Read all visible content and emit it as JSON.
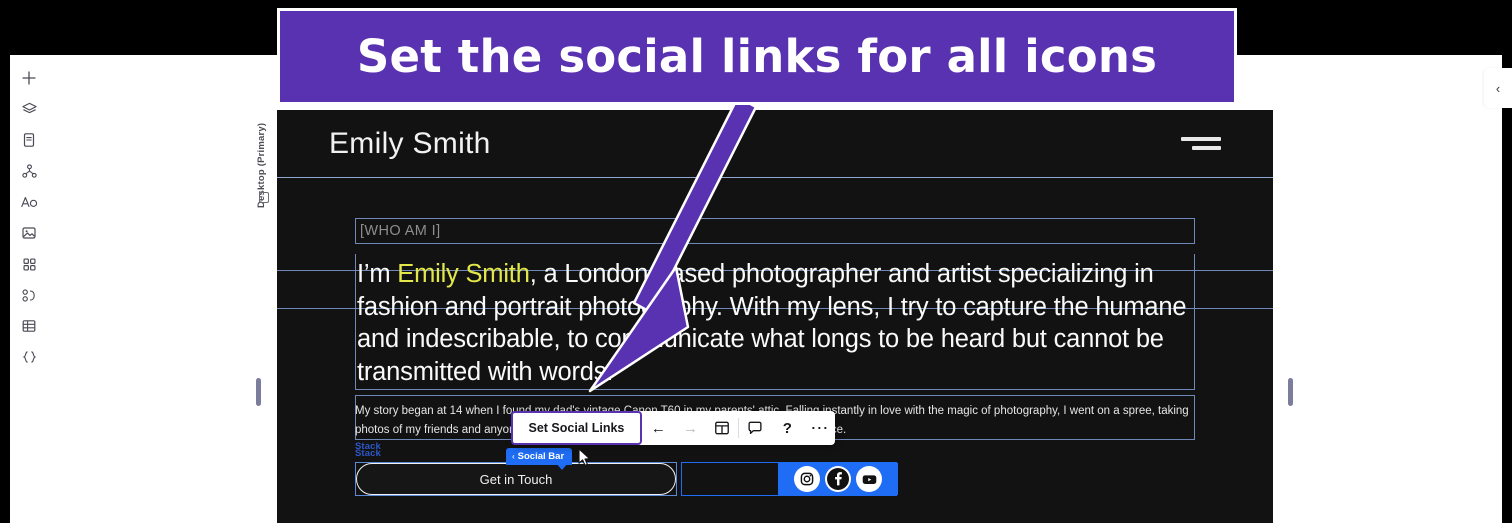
{
  "banner": {
    "text": "Set the social links for all icons",
    "bg_color": "#5832B0",
    "text_color": "#FFFFFF"
  },
  "sidebar": {
    "items": [
      {
        "name": "add-icon",
        "label": "Add"
      },
      {
        "name": "layers-icon",
        "label": "Layers"
      },
      {
        "name": "pages-icon",
        "label": "Pages"
      },
      {
        "name": "sitemap-icon",
        "label": "Site Map"
      },
      {
        "name": "text-style-icon",
        "label": "Text Styles"
      },
      {
        "name": "media-icon",
        "label": "Media"
      },
      {
        "name": "apps-icon",
        "label": "Apps"
      },
      {
        "name": "components-icon",
        "label": "Components"
      },
      {
        "name": "table-icon",
        "label": "CMS"
      },
      {
        "name": "code-icon",
        "label": "Dev Mode"
      }
    ]
  },
  "viewport": {
    "label": "Desktop (Primary)",
    "monitor_icon": "monitor-icon"
  },
  "right_panel": {
    "collapse_icon": "chevron-left-icon"
  },
  "site": {
    "header": {
      "title": "Emily Smith",
      "menu_icon": "hamburger-menu-icon"
    },
    "section_label": "[WHO AM I]",
    "lead": {
      "before": "I’m ",
      "highlight": "Emily Smith",
      "after": ", a London-based photographer and artist specializing in fashion and portrait photography. With my lens, I try to capture the humane and indescribable, to communicate what longs to be heard but cannot be transmitted with words.",
      "highlight_color": "#E3E84A"
    },
    "body_paragraph": "My story began at 14 when I found my dad's vintage Canon T60 in my parents' attic. Falling instantly in love with the magic of photography, I went on a spree, taking photos of my friends and anyone who'd let me shoot them. My work has gotten a lot better since.",
    "stack_tag": "Stack",
    "cta_label": "Get in Touch",
    "social": {
      "badge_label": "Social Bar",
      "badge_chevron": "‹",
      "badge_color": "#1F6DF5",
      "icons": [
        {
          "name": "instagram-icon",
          "label": "Instagram"
        },
        {
          "name": "facebook-icon",
          "label": "Facebook"
        },
        {
          "name": "youtube-icon",
          "label": "YouTube"
        }
      ]
    }
  },
  "toolbar": {
    "primary_label": "Set Social Links",
    "primary_border_color": "#5832B0",
    "buttons": [
      {
        "name": "back-arrow-icon",
        "glyph": "←",
        "label": "Back",
        "enabled": true
      },
      {
        "name": "forward-arrow-icon",
        "glyph": "→",
        "label": "Forward",
        "enabled": false
      },
      {
        "name": "layout-icon",
        "glyph": "",
        "label": "Layout",
        "enabled": true
      },
      {
        "name": "comment-icon",
        "glyph": "",
        "label": "Comment",
        "enabled": true
      },
      {
        "name": "help-icon",
        "glyph": "?",
        "label": "Help",
        "enabled": true
      },
      {
        "name": "more-options-icon",
        "glyph": "⋯",
        "label": "More",
        "enabled": true
      }
    ]
  }
}
